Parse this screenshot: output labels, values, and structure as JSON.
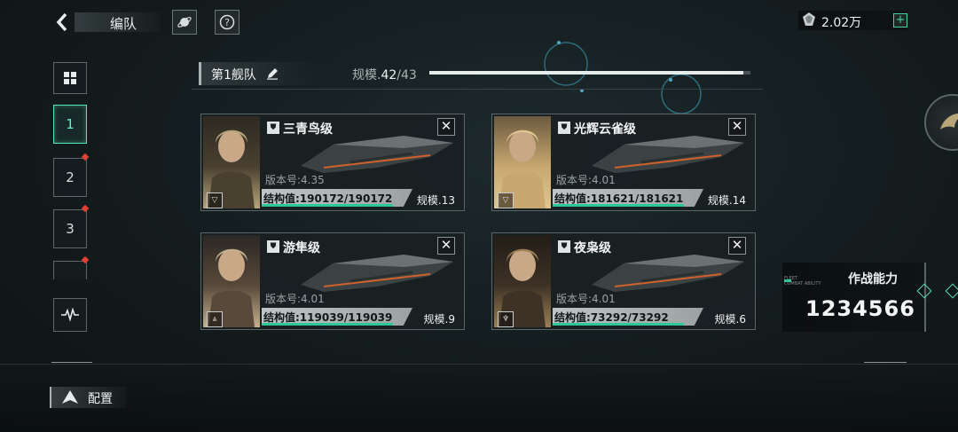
{
  "header": {
    "back_icon": "back-chevron-icon",
    "title": "编队",
    "planet_icon": "planet-icon",
    "help_icon": "question-icon",
    "currency_icon": "crystal-icon",
    "currency_value": "2.02万",
    "add_label": "+"
  },
  "sidebar": {
    "grid_icon": "grid-icon",
    "tabs": [
      {
        "label": "1",
        "active": true
      },
      {
        "label": "2",
        "badge": true
      },
      {
        "label": "3",
        "badge": true
      },
      {
        "label": "",
        "badge": true
      }
    ],
    "pulse_icon": "pulse-icon"
  },
  "fleet": {
    "name": "第1舰队",
    "edit_icon": "pencil-icon",
    "scale_label": "规模.",
    "scale_current": "42",
    "scale_sep": "/",
    "scale_max": "43",
    "scale_fraction": 0.977
  },
  "ships": [
    {
      "name": "三青鸟级",
      "version": "版本号:4.35",
      "hp": "结构值:190172/190172",
      "hp_fraction": 1.0,
      "scale": "规模.13",
      "rank": "▽"
    },
    {
      "name": "光辉云雀级",
      "version": "版本号:4.01",
      "hp": "结构值:181621/181621",
      "hp_fraction": 1.0,
      "scale": "规模.14",
      "rank": "▽"
    },
    {
      "name": "游隼级",
      "version": "版本号:4.01",
      "hp": "结构值:119039/119039",
      "hp_fraction": 1.0,
      "scale": "规模.9",
      "rank": "⩓"
    },
    {
      "name": "夜枭级",
      "version": "版本号:4.01",
      "hp": "结构值:73292/73292",
      "hp_fraction": 1.0,
      "scale": "规模.6",
      "rank": "♆"
    }
  ],
  "combat": {
    "tag_line1": "FLEET",
    "tag_line2": "COMBAT ABILITY",
    "label": "作战能力",
    "value": "1234566"
  },
  "bottom": {
    "config_icon": "fleet-config-icon",
    "config_label": "配置"
  },
  "colors": {
    "accent": "#55e0b7",
    "hp_bar": "#2fc79a",
    "badge": "#e24030"
  }
}
